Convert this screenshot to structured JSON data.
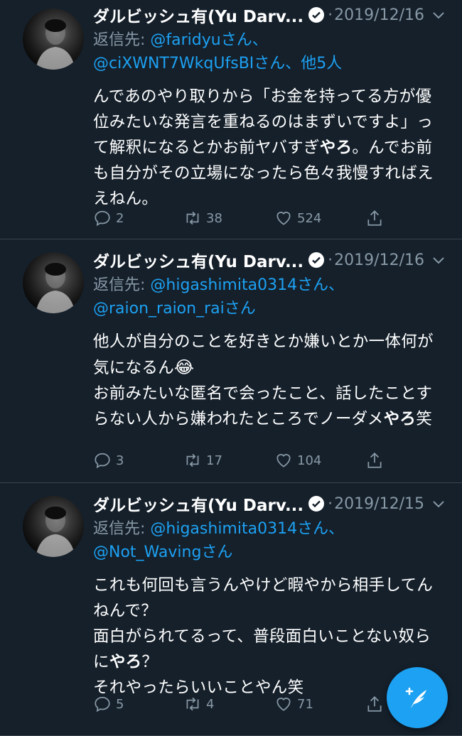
{
  "colors": {
    "background": "#15202b",
    "text": "#ffffff",
    "muted": "#8899a6",
    "accent": "#1da1f2",
    "divider": "#38444d"
  },
  "tweets": [
    {
      "author": "ダルビッシュ有(Yu Darv...",
      "separator": "·",
      "date": "2019/12/16",
      "reply_prefix": "返信先: ",
      "mention_1": "@faridyu",
      "san_1": "さん、",
      "mention_2": "@ciXWNT7WkqUfsBI",
      "san_2": "さん、",
      "others": "他5人",
      "text_1": "んであのやり取りから「お金を持ってる方が優位みたいな発言を重ねるのはまずいですよ」って解釈になるとかお前ヤバすぎ",
      "text_bold": "やろ",
      "text_2": "。んでお前も自分がその立場になったら色々我慢すればええねん。",
      "replies": "2",
      "retweets": "38",
      "likes": "524"
    },
    {
      "author": "ダルビッシュ有(Yu Darv...",
      "separator": "·",
      "date": "2019/12/16",
      "reply_prefix": "返信先: ",
      "mention_1": "@higashimita0314",
      "san_1": "さん、",
      "mention_2": "@raion_raion_rai",
      "san_2": "さん",
      "text_1": "他人が自分のことを好きとか嫌いとか一体何が気になるん",
      "emoji": "😂",
      "text_2": "お前みたいな匿名で会ったこと、話したことすらない人から嫌われたところでノーダメ",
      "text_bold": "やろ",
      "text_3": "笑",
      "replies": "3",
      "retweets": "17",
      "likes": "104"
    },
    {
      "author": "ダルビッシュ有(Yu Darv...",
      "separator": "·",
      "date": "2019/12/15",
      "reply_prefix": "返信先: ",
      "mention_1": "@higashimita0314",
      "san_1": "さん、",
      "mention_2": "@Not_Waving",
      "san_2": "さん",
      "text_1": "これも何回も言うんやけど暇やから相手してんねんで？",
      "text_2": "面白がられてるって、普段面白いことない奴らに",
      "text_bold": "やろ",
      "text_3": "？",
      "text_4": "それやったらいいことやん笑",
      "replies": "5",
      "retweets": "4",
      "likes": "71"
    }
  ],
  "icons": [
    "avatar",
    "verified-badge-icon",
    "chevron-down-icon",
    "reply-icon",
    "retweet-icon",
    "like-icon",
    "share-icon",
    "compose-tweet-icon"
  ]
}
